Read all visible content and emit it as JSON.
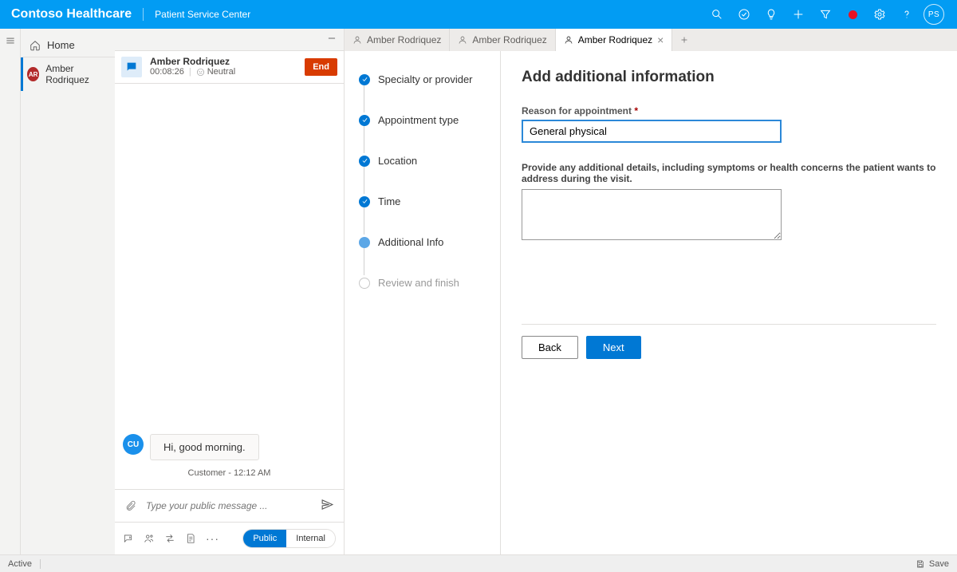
{
  "header": {
    "app_title": "Contoso Healthcare",
    "app_subtitle": "Patient Service Center",
    "user_initials": "PS"
  },
  "sidebar": {
    "home_label": "Home",
    "active_chat": {
      "initials": "AR",
      "name": "Amber Rodriquez"
    }
  },
  "chat": {
    "header": {
      "name": "Amber Rodriquez",
      "timer": "00:08:26",
      "sentiment": "Neutral",
      "end_label": "End"
    },
    "messages": [
      {
        "from": "customer",
        "initials": "CU",
        "text": "Hi, good morning."
      }
    ],
    "meta_line": "Customer - 12:12 AM",
    "input_placeholder": "Type your public message ...",
    "visibility": {
      "public": "Public",
      "internal": "Internal"
    }
  },
  "tabs": [
    {
      "label": "Amber Rodriquez",
      "active": false,
      "closable": false
    },
    {
      "label": "Amber Rodriquez",
      "active": false,
      "closable": false
    },
    {
      "label": "Amber Rodriquez",
      "active": true,
      "closable": true
    }
  ],
  "steps": [
    {
      "label": "Specialty or provider",
      "state": "done"
    },
    {
      "label": "Appointment type",
      "state": "done"
    },
    {
      "label": "Location",
      "state": "done"
    },
    {
      "label": "Time",
      "state": "done"
    },
    {
      "label": "Additional Info",
      "state": "current"
    },
    {
      "label": "Review and finish",
      "state": "pending"
    }
  ],
  "form": {
    "title": "Add additional information",
    "reason_label": "Reason for appointment",
    "reason_value": "General physical",
    "details_label": "Provide any additional details, including symptoms or health concerns the patient wants to address during the visit.",
    "details_value": "",
    "back_label": "Back",
    "next_label": "Next"
  },
  "statusbar": {
    "active": "Active",
    "save": "Save"
  }
}
